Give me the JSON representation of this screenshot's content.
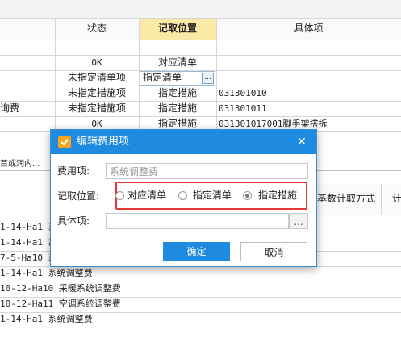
{
  "grid": {
    "headers": {
      "status": "状态",
      "position": "记取位置",
      "item": "具体项"
    },
    "rows": [
      {
        "col0": "",
        "status": "",
        "position": "",
        "item": ""
      },
      {
        "col0": "",
        "status": "OK",
        "position": "对应清单",
        "item": ""
      },
      {
        "col0": "",
        "status": "未指定清单项",
        "position": "指定清单",
        "item": ""
      },
      {
        "col0": "",
        "status": "未指定措施项",
        "position": "指定措施",
        "item": "031301010"
      },
      {
        "col0": "询费",
        "status": "未指定措施项",
        "position": "指定措施",
        "item": "031301011"
      },
      {
        "col0": "",
        "status": "OK",
        "position": "指定措施",
        "item": "031301017001脚手架搭拆"
      }
    ],
    "ellipsis": "...",
    "partial_left": "首或润内..."
  },
  "lower_panel": {
    "col_header_1": "基数计取方式",
    "col_header_2": "计",
    "rows": [
      "1-14-Ha1 系",
      "1-14-Ha1 系",
      "7-5-Ha10 系",
      "1-14-Ha1 系统调整费",
      "10-12-Ha10 采暖系统调整费",
      "10-12-Ha11 空调系统调整费",
      "1-14-Ha1 系统调整费"
    ]
  },
  "dialog": {
    "title": "编辑费用项",
    "fee_label": "费用项:",
    "fee_value": "系统调整费",
    "position_label": "记取位置:",
    "options": [
      {
        "label": "对应清单",
        "selected": false
      },
      {
        "label": "指定清单",
        "selected": false
      },
      {
        "label": "指定措施",
        "selected": true
      }
    ],
    "item_label": "具体项:",
    "item_value": "",
    "browse_label": "...",
    "ok_label": "确定",
    "cancel_label": "取消"
  },
  "colors": {
    "title_bar": "#1e8ae0",
    "highlight_box": "#e53935",
    "header_selected": "#fbe9a8"
  }
}
